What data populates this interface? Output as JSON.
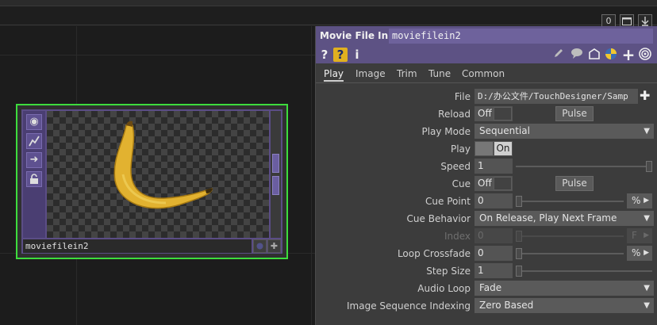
{
  "toolbar": {
    "counter": "0",
    "window_icon": "maximize-icon",
    "download_icon": "download-icon"
  },
  "node": {
    "name": "moviefilein2",
    "side_icons": [
      "viewer-icon",
      "bypass-icon",
      "arrow-right-icon",
      "lock-icon"
    ],
    "preview": "banana"
  },
  "panel": {
    "title": "Movie File In",
    "name": "moviefilein2",
    "icons": [
      "help-icon",
      "python-help-icon",
      "info-icon",
      "edit-icon",
      "comment-icon",
      "clone-icon",
      "python-icon",
      "add-icon",
      "target-icon"
    ],
    "help_label": "?",
    "info_label": "i",
    "tabs": [
      "Play",
      "Image",
      "Trim",
      "Tune",
      "Common"
    ],
    "active_tab": "Play",
    "params": {
      "file": {
        "label": "File",
        "value": "D:/办公文件/TouchDesigner/Samp"
      },
      "reload": {
        "label": "Reload",
        "value": "Off",
        "button": "Pulse"
      },
      "play_mode": {
        "label": "Play Mode",
        "value": "Sequential"
      },
      "play": {
        "label": "Play",
        "value": "On"
      },
      "speed": {
        "label": "Speed",
        "value": "1"
      },
      "cue": {
        "label": "Cue",
        "value": "Off",
        "button": "Pulse"
      },
      "cue_point": {
        "label": "Cue Point",
        "value": "0",
        "unit": "%"
      },
      "cue_behavior": {
        "label": "Cue Behavior",
        "value": "On Release, Play Next Frame"
      },
      "index": {
        "label": "Index",
        "value": "0",
        "unit": "F"
      },
      "loop_crossfade": {
        "label": "Loop Crossfade",
        "value": "0",
        "unit": "%"
      },
      "step_size": {
        "label": "Step Size",
        "value": "1"
      },
      "audio_loop": {
        "label": "Audio Loop",
        "value": "Fade"
      },
      "image_sequence_indexing": {
        "label": "Image Sequence Indexing",
        "value": "Zero Based"
      }
    }
  },
  "colors": {
    "node_border": "#3ddc3d",
    "header": "#5d5284",
    "panel_bg": "#3c3c3c"
  }
}
